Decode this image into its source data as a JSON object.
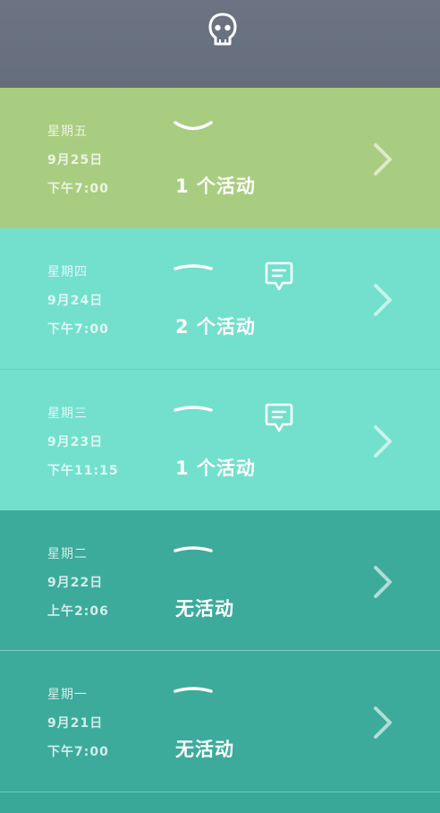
{
  "header": {
    "icon": "skull-logo-icon"
  },
  "days": [
    {
      "weekday": "星期五",
      "date": "9月25日",
      "time": "下午7:00",
      "activity": "1 个活动",
      "mood_icon": "smile-mouth-icon",
      "has_comment": false,
      "bg": "#a9cd80"
    },
    {
      "weekday": "星期四",
      "date": "9月24日",
      "time": "下午7:00",
      "activity": "2 个活动",
      "mood_icon": "neutral-mouth-icon",
      "has_comment": true,
      "bg": "#72e0cd"
    },
    {
      "weekday": "星期三",
      "date": "9月23日",
      "time": "下午11:15",
      "activity": "1 个活动",
      "mood_icon": "neutral-mouth-icon",
      "has_comment": true,
      "bg": "#72e0cd"
    },
    {
      "weekday": "星期二",
      "date": "9月22日",
      "time": "上午2:06",
      "activity": "无活动",
      "mood_icon": "neutral-mouth-icon",
      "has_comment": false,
      "bg": "#3cab9b"
    },
    {
      "weekday": "星期一",
      "date": "9月21日",
      "time": "下午7:00",
      "activity": "无活动",
      "mood_icon": "neutral-mouth-icon",
      "has_comment": false,
      "bg": "#3cab9b"
    }
  ],
  "colors": {
    "header": "#6a7280",
    "green": "#a9cd80",
    "aqua": "#72e0cd",
    "teal": "#3cab9b"
  }
}
